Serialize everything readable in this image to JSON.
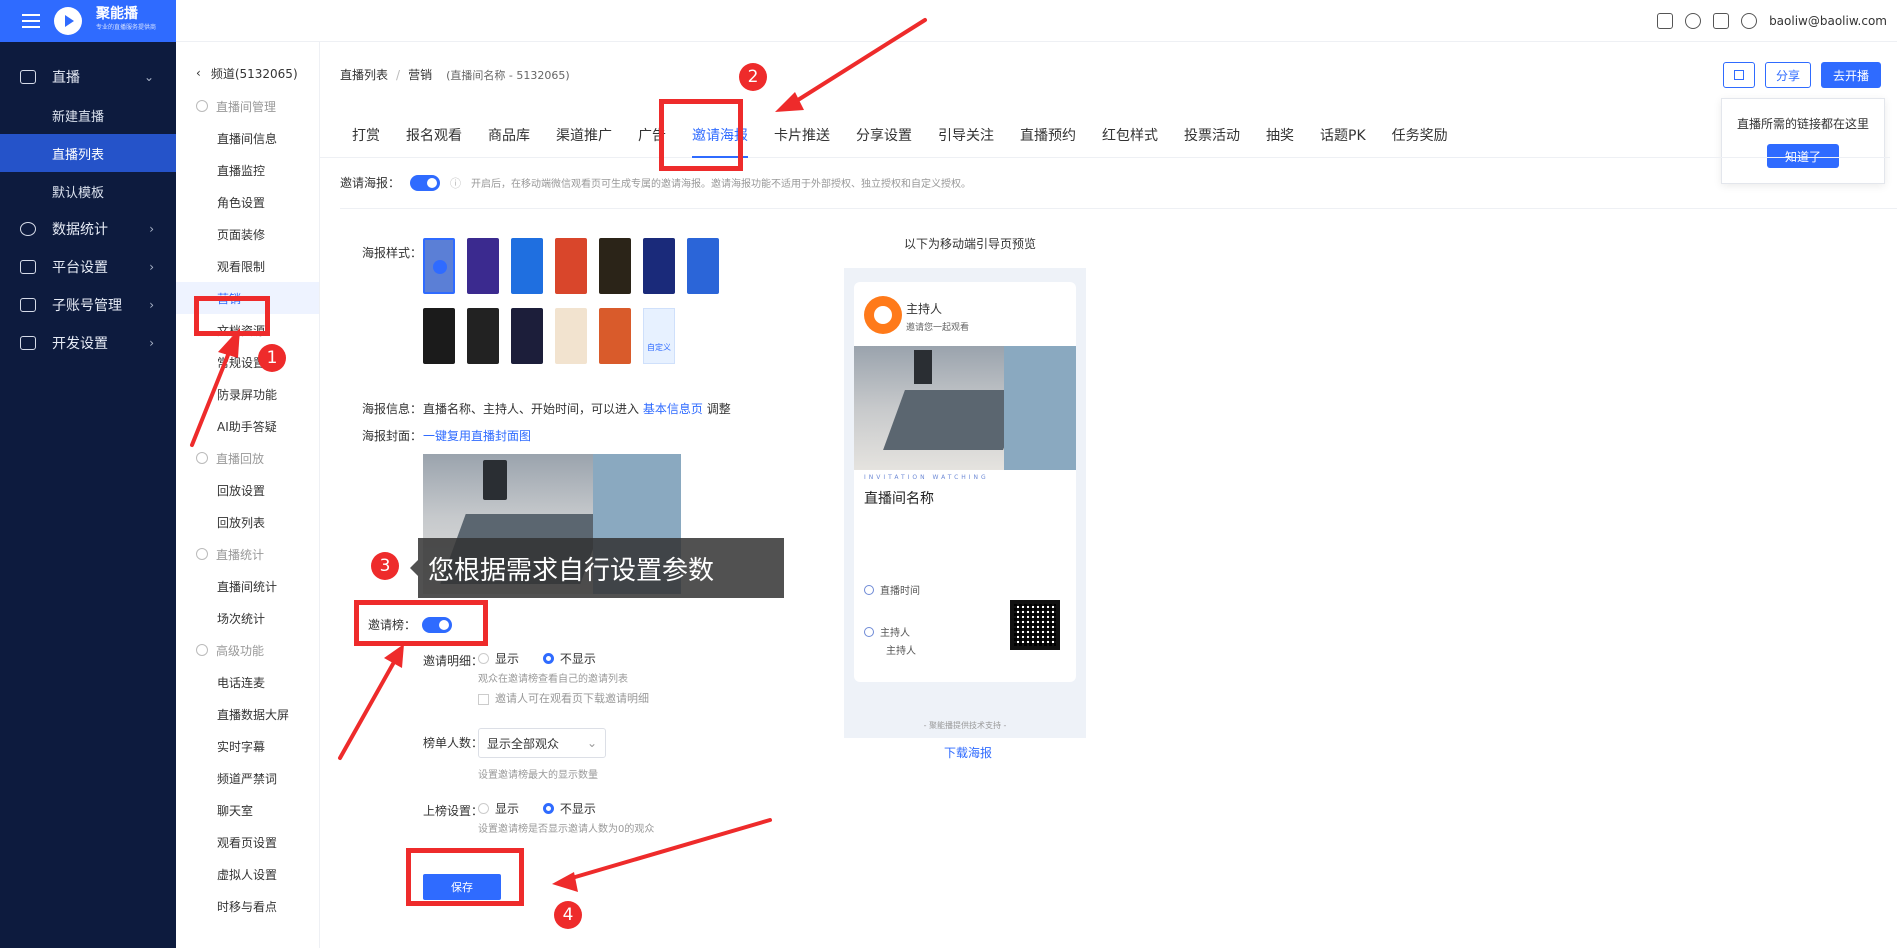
{
  "brand": {
    "name": "聚能播",
    "tagline": "专业的直播服务提供商"
  },
  "user": {
    "email": "baoliw@baoliw.com"
  },
  "nav": {
    "items": [
      {
        "label": "直播",
        "arrow": "⌄"
      },
      {
        "label": "数据统计",
        "arrow": "›"
      },
      {
        "label": "平台设置",
        "arrow": "›"
      },
      {
        "label": "子账号管理",
        "arrow": "›"
      },
      {
        "label": "开发设置",
        "arrow": "›"
      }
    ],
    "subs": [
      "新建直播",
      "直播列表",
      "默认模板"
    ]
  },
  "sub": {
    "channel": "频道(5132065)",
    "groups": [
      "直播间管理",
      "直播回放",
      "直播统计",
      "高级功能"
    ],
    "g1": [
      "直播间信息",
      "直播监控",
      "角色设置",
      "页面装修",
      "观看限制",
      "营销",
      "文档资源",
      "常规设置",
      "防录屏功能",
      "AI助手答疑"
    ],
    "g2": [
      "回放设置",
      "回放列表"
    ],
    "g3": [
      "直播间统计",
      "场次统计"
    ],
    "g4": [
      "电话连麦",
      "直播数据大屏",
      "实时字幕",
      "频道严禁词",
      "聊天室",
      "观看页设置",
      "虚拟人设置",
      "时移与看点"
    ]
  },
  "crumb": {
    "list": "直播列表",
    "sep": "/",
    "current": "营销",
    "meta": "(直播间名称 - 5132065)"
  },
  "actions": {
    "copy_icon": "copy-icon",
    "share": "分享",
    "start": "去开播"
  },
  "tip": {
    "text": "直播所需的链接都在这里",
    "ok": "知道了"
  },
  "tabs": [
    "打赏",
    "报名观看",
    "商品库",
    "渠道推广",
    "广告",
    "邀请海报",
    "卡片推送",
    "分享设置",
    "引导关注",
    "直播预约",
    "红包样式",
    "投票活动",
    "抽奖",
    "话题PK",
    "任务奖励"
  ],
  "invite": {
    "label": "邀请海报：",
    "hint": "开启后，在移动端微信观看页可生成专属的邀请海报。邀请海报功能不适用于外部授权、独立授权和自定义授权。"
  },
  "poster": {
    "style_label": "海报样式：",
    "custom": "自定义",
    "info_label": "海报信息：",
    "info_text": "直播名称、主持人、开始时间，可以进入",
    "info_link": "基本信息页",
    "info_tail": "调整",
    "cover_label": "海报封面：",
    "cover_link": "一键复用直播封面图"
  },
  "tooltip": "您根据需求自行设置参数",
  "rank": {
    "label": "邀请榜：",
    "detail_label": "邀请明细：",
    "show": "显示",
    "hide": "不显示",
    "detail_hint": "观众在邀请榜查看自己的邀请列表",
    "download_hint": "邀请人可在观看页下载邀请明细",
    "count_label": "榜单人数：",
    "count_value": "显示全部观众",
    "count_hint": "设置邀请榜最大的显示数量",
    "onlist_label": "上榜设置：",
    "onlist_hint": "设置邀请榜是否显示邀请人数为0的观众"
  },
  "save": "保存",
  "preview": {
    "title": "以下为移动端引导页预览",
    "host": "主持人",
    "invite": "邀请您一起观看",
    "sub": "INVITATION WATCHING",
    "name": "直播间名称",
    "time": "直播时间",
    "host_label": "主持人",
    "host_value": "主持人",
    "footer": "- 聚能播提供技术支持 -",
    "download": "下载海报"
  },
  "badges": [
    "1",
    "2",
    "3",
    "4"
  ],
  "colors": {
    "accent": "#2f6bff",
    "nav_bg": "#0d1b3e",
    "annotation": "#ee2b2b"
  }
}
